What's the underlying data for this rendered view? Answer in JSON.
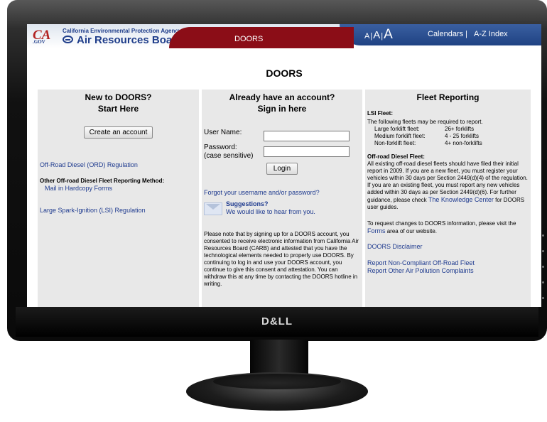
{
  "header": {
    "ca_logo": "CA",
    "ca_logo_sub": ".GOV",
    "agency": "California Environmental Protection Agency",
    "board": "Air Resources Board",
    "app_tab": "DOORS",
    "font_small": "A",
    "font_medium": "A",
    "font_large": "A",
    "sep": "|",
    "link_calendars": "Calendars",
    "link_az": "A-Z Index"
  },
  "page_title": "DOORS",
  "new_col": {
    "title_line1": "New to DOORS?",
    "title_line2": "Start Here",
    "create_button": "Create an account",
    "orD_link": "Off-Road Diesel (ORD) Regulation",
    "other_heading": "Other Off-road Diesel Fleet Reporting Method:",
    "mail_link": "Mail in Hardcopy Forms",
    "lsi_link": "Large Spark-Ignition (LSI) Regulation"
  },
  "signin_col": {
    "title_line1": "Already have an account?",
    "title_line2": "Sign in here",
    "username_label": "User Name:",
    "password_label": "Password:",
    "password_note": "(case sensitive)",
    "username_value": "",
    "password_value": "",
    "login_button": "Login",
    "forgot_link": "Forgot your username and/or password?",
    "suggestions_title": "Suggestions?",
    "suggestions_text": "We would like to hear from you.",
    "consent_text": "Please note that by signing up for a DOORS account, you consented to receive electronic information from California Air Resources Board (CARB) and attested that you have the technological elements needed to properly use DOORS. By continuing to log in and use your DOORS account, you continue to give this consent and attestation. You can withdraw this at any time by contacting the DOORS hotline in writing."
  },
  "fleet_col": {
    "title": "Fleet Reporting",
    "lsi_heading": "LSI Fleet:",
    "lsi_intro": "The following fleets may be required to report.",
    "fleet_rows": [
      {
        "type": "Large forklift fleet:",
        "count": "26+ forklifts"
      },
      {
        "type": "Medium forklift fleet:",
        "count": "4 - 25 forklifts"
      },
      {
        "type": "Non-forklift fleet:",
        "count": "4+ non-forklifts"
      }
    ],
    "ord_heading": "Off-road Diesel Fleet:",
    "ord_text": "All existing off-road diesel fleets should have filed their initial report in 2009. If you are a new fleet, you must register your vehicles within 30 days per Section 2449(d)(4) of the regulation. If you are an existing fleet, you must report any new vehicles added within 30 days as per Section 2449(d)(6). For further guidance, please check",
    "knowledge_link": "The Knowledge Center",
    "knowledge_suffix": "for DOORS user guides.",
    "request_prefix": "To request changes to DOORS information, please visit the",
    "forms_link": "Forms",
    "request_suffix": "area of our website.",
    "disclaimer_link": "DOORS Disclaimer",
    "report_link1": "Report Non-Compliant Off-Road Fleet",
    "report_link2": "Report Other Air Pollution Complaints"
  },
  "monitor": {
    "brand": "D&LL"
  },
  "colors": {
    "red_tab": "#8b0d17",
    "blue_tab": "#1f4283",
    "link": "#1f3b8f",
    "panel": "#e8e8e8"
  }
}
